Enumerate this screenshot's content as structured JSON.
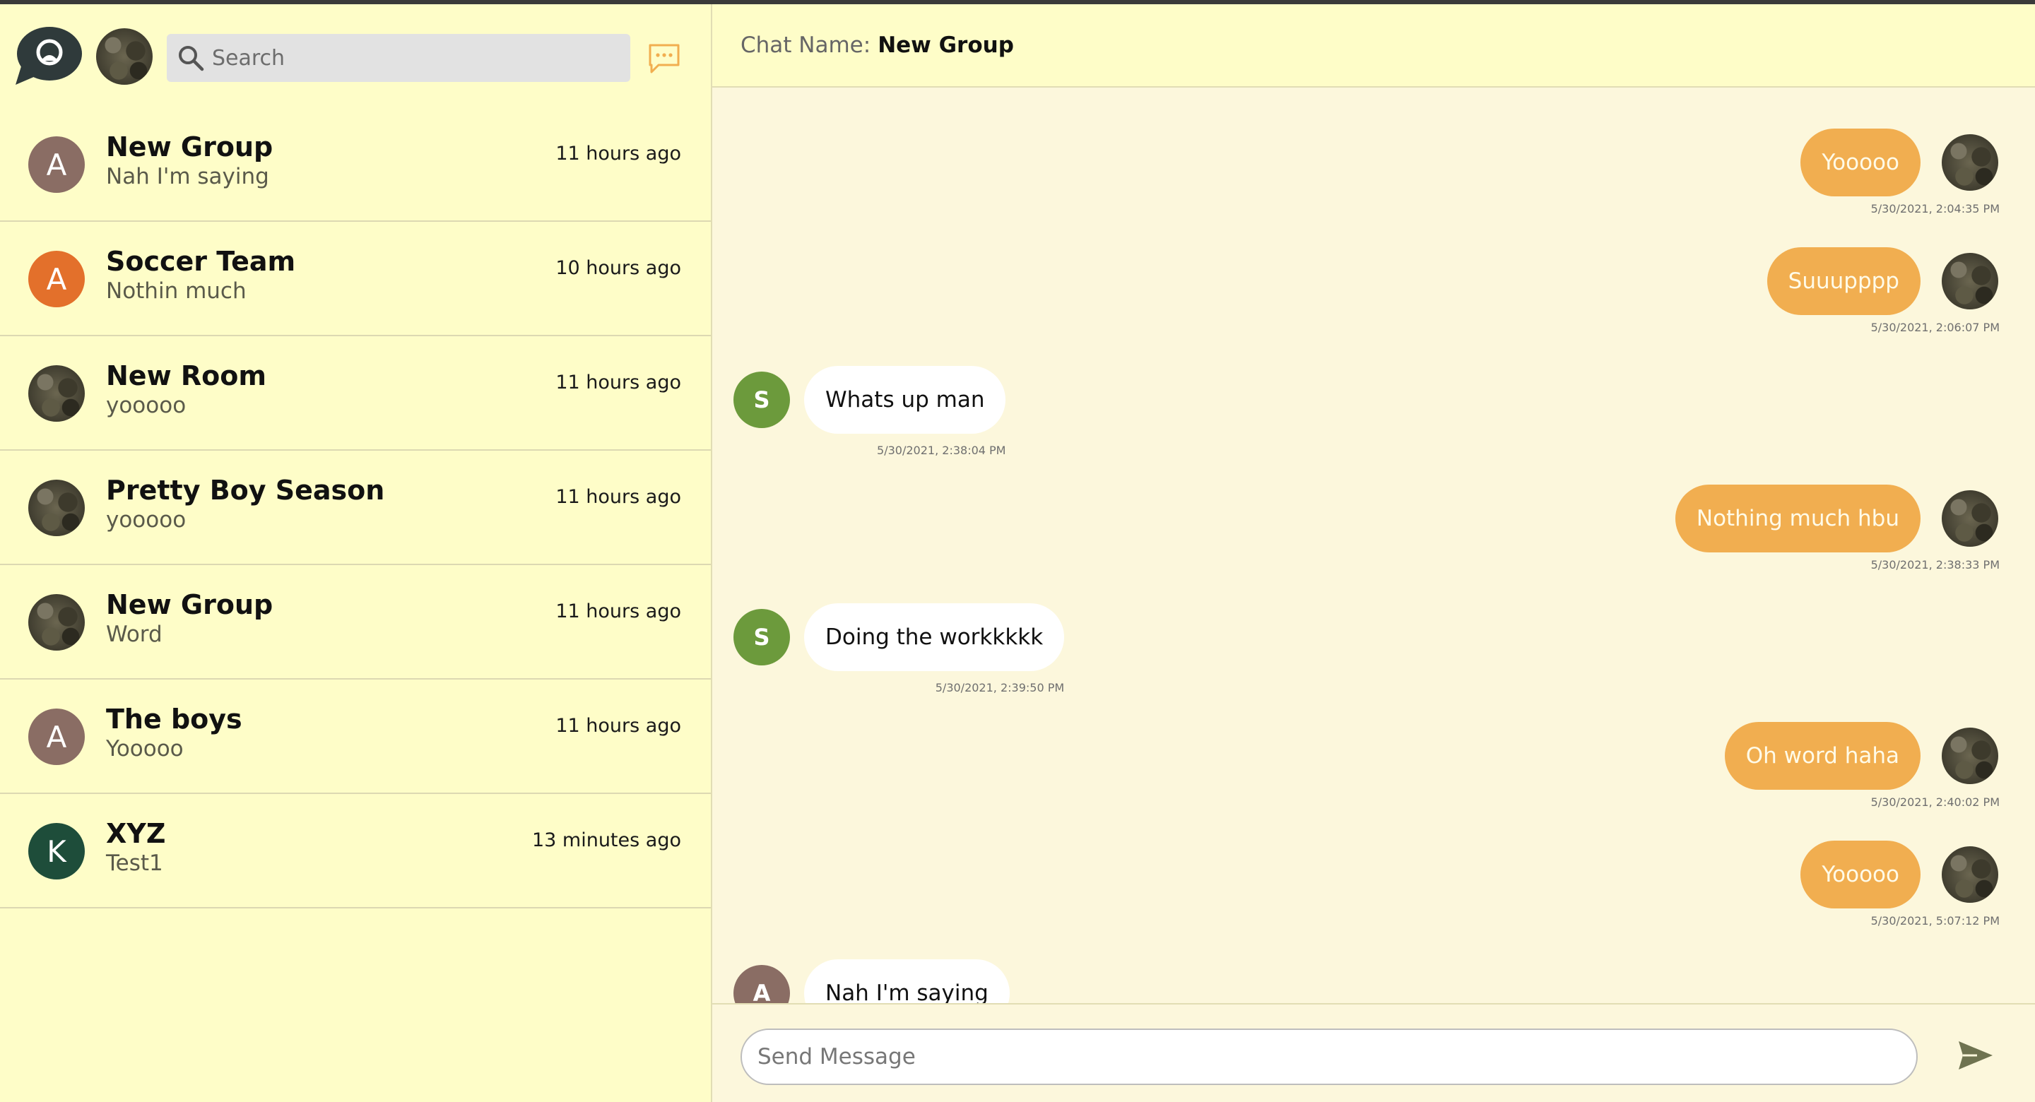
{
  "colors": {
    "sidebar_bg": "#fefdc8",
    "main_bg": "#fcf7dc",
    "outgoing_bubble": "#f1ae50",
    "incoming_bubble": "#ffffff",
    "accent_icon": "#f1ae50"
  },
  "sidebar": {
    "search_placeholder": "Search",
    "chats": [
      {
        "name": "New Group",
        "last": "Nah I'm saying",
        "time": "11 hours ago",
        "avatar": "A",
        "avatar_color": "#8a6d64"
      },
      {
        "name": "Soccer Team",
        "last": "Nothin much",
        "time": "10 hours ago",
        "avatar": "A",
        "avatar_color": "#e3702b"
      },
      {
        "name": "New Room",
        "last": "yooooo",
        "time": "11 hours ago",
        "avatar": "",
        "avatar_color": "photo"
      },
      {
        "name": "Pretty Boy Season",
        "last": "yooooo",
        "time": "11 hours ago",
        "avatar": "",
        "avatar_color": "photo"
      },
      {
        "name": "New Group",
        "last": "Word",
        "time": "11 hours ago",
        "avatar": "",
        "avatar_color": "photo"
      },
      {
        "name": "The boys",
        "last": "Yooooo",
        "time": "11 hours ago",
        "avatar": "A",
        "avatar_color": "#8a6d64"
      },
      {
        "name": "XYZ",
        "last": "Test1",
        "time": "13 minutes ago",
        "avatar": "K",
        "avatar_color": "#1e4d3a"
      }
    ]
  },
  "chat": {
    "label": "Chat Name:",
    "name": "New Group",
    "messages": [
      {
        "dir": "out",
        "text": "Yooooo",
        "stamp": "5/30/2021, 2:04:35 PM"
      },
      {
        "dir": "out",
        "text": "Suuupppp",
        "stamp": "5/30/2021, 2:06:07 PM"
      },
      {
        "dir": "in",
        "text": "Whats up man",
        "stamp": "5/30/2021, 2:38:04 PM",
        "avatar": "S",
        "avatar_color": "#6c9a3c"
      },
      {
        "dir": "out",
        "text": "Nothing much hbu",
        "stamp": "5/30/2021, 2:38:33 PM"
      },
      {
        "dir": "in",
        "text": "Doing the workkkkk",
        "stamp": "5/30/2021, 2:39:50 PM",
        "avatar": "S",
        "avatar_color": "#6c9a3c"
      },
      {
        "dir": "out",
        "text": "Oh word haha",
        "stamp": "5/30/2021, 2:40:02 PM"
      },
      {
        "dir": "out",
        "text": "Yooooo",
        "stamp": "5/30/2021, 5:07:12 PM"
      },
      {
        "dir": "in",
        "text": "Nah I'm saying",
        "stamp": "",
        "avatar": "A",
        "avatar_color": "#8a6d64"
      }
    ],
    "composer_placeholder": "Send Message"
  },
  "icons": {
    "logo": "chat-bubble-logo-icon",
    "search": "search-icon",
    "new_chat": "new-chat-icon",
    "send": "send-icon"
  }
}
